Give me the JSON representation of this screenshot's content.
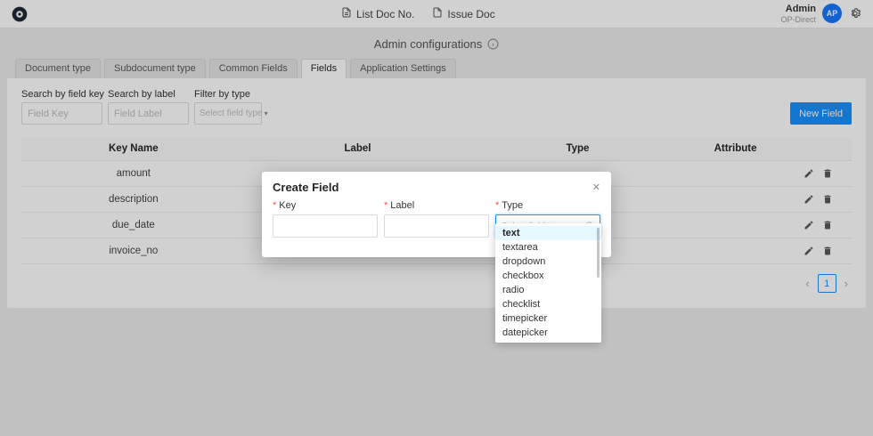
{
  "header": {
    "nav": [
      {
        "label": "List Doc No.",
        "icon": "doc-list-icon"
      },
      {
        "label": "Issue Doc",
        "icon": "doc-icon"
      }
    ],
    "user": {
      "name": "Admin",
      "org": "OP-Direct",
      "avatar_initials": "AP"
    }
  },
  "page": {
    "title": "Admin configurations"
  },
  "tabs": [
    {
      "label": "Document type",
      "active": false
    },
    {
      "label": "Subdocument type",
      "active": false
    },
    {
      "label": "Common Fields",
      "active": false
    },
    {
      "label": "Fields",
      "active": true
    },
    {
      "label": "Application Settings",
      "active": false
    }
  ],
  "filters": {
    "search_key": {
      "label": "Search by field key",
      "placeholder": "Field Key",
      "value": ""
    },
    "search_label": {
      "label": "Search by label",
      "placeholder": "Field Label",
      "value": ""
    },
    "filter_type": {
      "label": "Filter by type",
      "placeholder": "Select field type"
    },
    "new_field_button": "New Field"
  },
  "table": {
    "columns": [
      "Key Name",
      "Label",
      "Type",
      "Attribute"
    ],
    "rows": [
      {
        "key_name": "amount",
        "label": "",
        "type": "",
        "attribute": ""
      },
      {
        "key_name": "description",
        "label": "",
        "type": "",
        "attribute": ""
      },
      {
        "key_name": "due_date",
        "label": "",
        "type": "",
        "attribute": ""
      },
      {
        "key_name": "invoice_no",
        "label": "",
        "type": "",
        "attribute": ""
      }
    ]
  },
  "pagination": {
    "prev": "‹",
    "current_page": "1",
    "next": "›"
  },
  "modal": {
    "title": "Create Field",
    "close_glyph": "✕",
    "required_mark": "*",
    "key_field": {
      "label": "Key",
      "value": ""
    },
    "label_field": {
      "label": "Label",
      "value": ""
    },
    "type_field": {
      "label": "Type",
      "placeholder": "Select field type"
    },
    "type_options": [
      "text",
      "textarea",
      "dropdown",
      "checkbox",
      "radio",
      "checklist",
      "timepicker",
      "datepicker"
    ],
    "selected_option": "text"
  },
  "glyphs": {
    "select_caret": "▾"
  },
  "colors": {
    "accent": "#1890ff",
    "avatar_bg": "#1677ff",
    "required_mark": "#ff4d4f",
    "table_header_bg": "#fafafa"
  }
}
